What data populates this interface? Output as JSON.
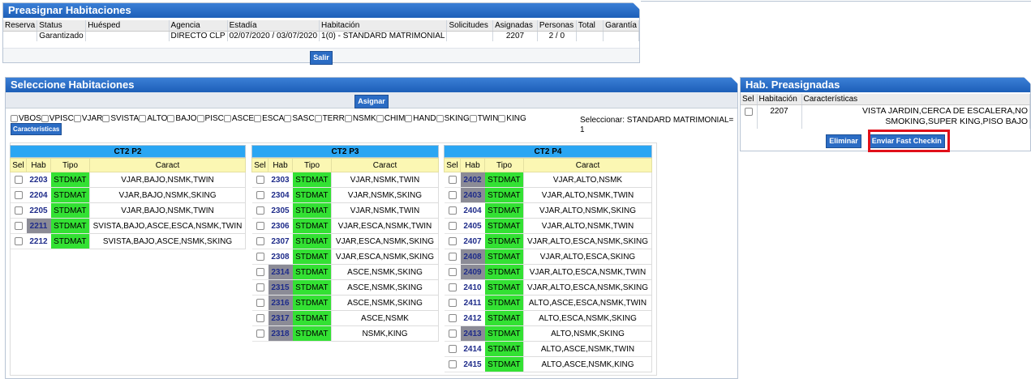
{
  "preasignar": {
    "title": "Preasignar Habitaciones",
    "columns": [
      "Reserva",
      "Status",
      "Huésped",
      "Agencia",
      "Estadía",
      "Habitación",
      "Solicitudes",
      "Asignadas",
      "Personas",
      "Total",
      "Garantía"
    ],
    "row": {
      "reserva": "",
      "status": "Garantizado",
      "huesped": "",
      "agencia": "DIRECTO CLP",
      "estadia": "02/07/2020 / 03/07/2020",
      "habitacion": "1(0) - STANDARD MATRIMONIAL",
      "solicitudes": "",
      "asignadas": "2207",
      "personas": "2 / 0",
      "total": "",
      "garantia": ""
    },
    "salir_label": "Salir"
  },
  "seleccione": {
    "title": "Seleccione Habitaciones",
    "asignar_label": "Asignar",
    "features": [
      "VBOS",
      "VPISC",
      "VJAR",
      "SVISTA",
      "ALTO",
      "BAJO",
      "PISC",
      "ASCE",
      "ESCA",
      "SASC",
      "TERR",
      "NSMK",
      "CHIM",
      "HAND",
      "SKING",
      "TWIN",
      "KING"
    ],
    "caracteristicas_label": "Características",
    "seleccionar_text": "Seleccionar: STANDARD MATRIMONIAL= 1",
    "col_headers": {
      "sel": "Sel",
      "hab": "Hab",
      "tipo": "Tipo",
      "caract": "Caract"
    },
    "groups": [
      {
        "name": "CT2 P2",
        "rooms": [
          {
            "hab": "2203",
            "tipo": "STDMAT",
            "caract": "VJAR,BAJO,NSMK,TWIN",
            "grey": false
          },
          {
            "hab": "2204",
            "tipo": "STDMAT",
            "caract": "VJAR,BAJO,NSMK,SKING",
            "grey": false
          },
          {
            "hab": "2205",
            "tipo": "STDMAT",
            "caract": "VJAR,BAJO,NSMK,TWIN",
            "grey": false
          },
          {
            "hab": "2211",
            "tipo": "STDMAT",
            "caract": "SVISTA,BAJO,ASCE,ESCA,NSMK,TWIN",
            "grey": true
          },
          {
            "hab": "2212",
            "tipo": "STDMAT",
            "caract": "SVISTA,BAJO,ASCE,NSMK,SKING",
            "grey": false
          }
        ]
      },
      {
        "name": "CT2 P3",
        "rooms": [
          {
            "hab": "2303",
            "tipo": "STDMAT",
            "caract": "VJAR,NSMK,TWIN",
            "grey": false
          },
          {
            "hab": "2304",
            "tipo": "STDMAT",
            "caract": "VJAR,NSMK,SKING",
            "grey": false
          },
          {
            "hab": "2305",
            "tipo": "STDMAT",
            "caract": "VJAR,NSMK,TWIN",
            "grey": false
          },
          {
            "hab": "2306",
            "tipo": "STDMAT",
            "caract": "VJAR,ESCA,NSMK,TWIN",
            "grey": false
          },
          {
            "hab": "2307",
            "tipo": "STDMAT",
            "caract": "VJAR,ESCA,NSMK,SKING",
            "grey": false
          },
          {
            "hab": "2308",
            "tipo": "STDMAT",
            "caract": "VJAR,ESCA,NSMK,SKING",
            "grey": false
          },
          {
            "hab": "2314",
            "tipo": "STDMAT",
            "caract": "ASCE,NSMK,SKING",
            "grey": true
          },
          {
            "hab": "2315",
            "tipo": "STDMAT",
            "caract": "ASCE,NSMK,SKING",
            "grey": true
          },
          {
            "hab": "2316",
            "tipo": "STDMAT",
            "caract": "ASCE,NSMK,SKING",
            "grey": true
          },
          {
            "hab": "2317",
            "tipo": "STDMAT",
            "caract": "ASCE,NSMK",
            "grey": true
          },
          {
            "hab": "2318",
            "tipo": "STDMAT",
            "caract": "NSMK,KING",
            "grey": true
          }
        ]
      },
      {
        "name": "CT2 P4",
        "rooms": [
          {
            "hab": "2402",
            "tipo": "STDMAT",
            "caract": "VJAR,ALTO,NSMK",
            "grey": true
          },
          {
            "hab": "2403",
            "tipo": "STDMAT",
            "caract": "VJAR,ALTO,NSMK,TWIN",
            "grey": true
          },
          {
            "hab": "2404",
            "tipo": "STDMAT",
            "caract": "VJAR,ALTO,NSMK,SKING",
            "grey": false
          },
          {
            "hab": "2405",
            "tipo": "STDMAT",
            "caract": "VJAR,ALTO,NSMK,TWIN",
            "grey": false
          },
          {
            "hab": "2407",
            "tipo": "STDMAT",
            "caract": "VJAR,ALTO,ESCA,NSMK,SKING",
            "grey": false
          },
          {
            "hab": "2408",
            "tipo": "STDMAT",
            "caract": "VJAR,ALTO,ESCA,SKING",
            "grey": true
          },
          {
            "hab": "2409",
            "tipo": "STDMAT",
            "caract": "VJAR,ALTO,ESCA,NSMK,TWIN",
            "grey": true
          },
          {
            "hab": "2410",
            "tipo": "STDMAT",
            "caract": "VJAR,ALTO,ESCA,NSMK,SKING",
            "grey": false
          },
          {
            "hab": "2411",
            "tipo": "STDMAT",
            "caract": "ALTO,ASCE,ESCA,NSMK,TWIN",
            "grey": false
          },
          {
            "hab": "2412",
            "tipo": "STDMAT",
            "caract": "ALTO,ESCA,NSMK,SKING",
            "grey": false
          },
          {
            "hab": "2413",
            "tipo": "STDMAT",
            "caract": "ALTO,NSMK,SKING",
            "grey": true
          },
          {
            "hab": "2414",
            "tipo": "STDMAT",
            "caract": "ALTO,ASCE,NSMK,TWIN",
            "grey": false
          },
          {
            "hab": "2415",
            "tipo": "STDMAT",
            "caract": "ALTO,ASCE,NSMK,KING",
            "grey": false
          }
        ]
      }
    ]
  },
  "preasignadas": {
    "title": "Hab. Preasignadas",
    "col_sel": "Sel",
    "col_hab": "Habitación",
    "col_car": "Características",
    "row_hab": "2207",
    "row_car": "VISTA JARDIN,CERCA DE ESCALERA,NO SMOKING,SUPER KING,PISO BAJO",
    "eliminar_label": "Eliminar",
    "fast_checkin_label": "Enviar Fast Checkin"
  },
  "colors": {
    "title_bar": "#1d5fb8",
    "group_header": "#2aa6f3",
    "tipo_green": "#33e133",
    "highlight_red": "#e0101a"
  }
}
